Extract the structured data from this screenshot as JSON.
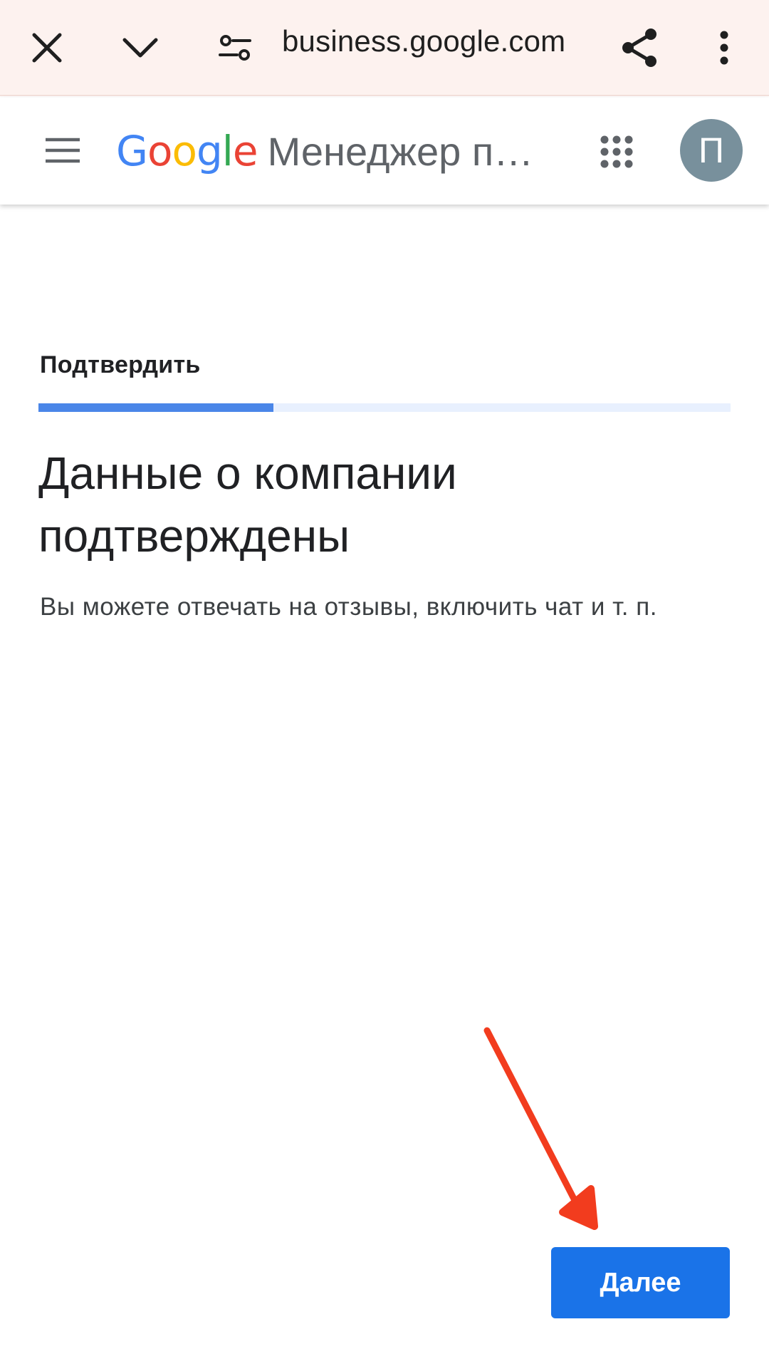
{
  "browser": {
    "url": "business.google.com",
    "icons": [
      "close-icon",
      "chevron-down-icon",
      "site-settings-icon",
      "share-icon",
      "more-vert-icon"
    ]
  },
  "header": {
    "google_letters": [
      "G",
      "o",
      "o",
      "g",
      "l",
      "e"
    ],
    "product_name": "Менеджер профилей компаний",
    "avatar_letter": "П",
    "icons": [
      "menu-icon",
      "apps-grid-icon"
    ]
  },
  "main": {
    "step_label": "Подтвердить",
    "progress_fraction": 0.34,
    "headline": "Данные о компании подтверждены",
    "subtext": "Вы можете отвечать на отзывы, включить чат и т. п.",
    "next_label": "Далее"
  },
  "colors": {
    "browser_bar": "#fdf2ef",
    "progress": "#4a86e8",
    "button": "#1a73e8",
    "arrow": "#f23c1e",
    "avatar": "#78909c"
  }
}
